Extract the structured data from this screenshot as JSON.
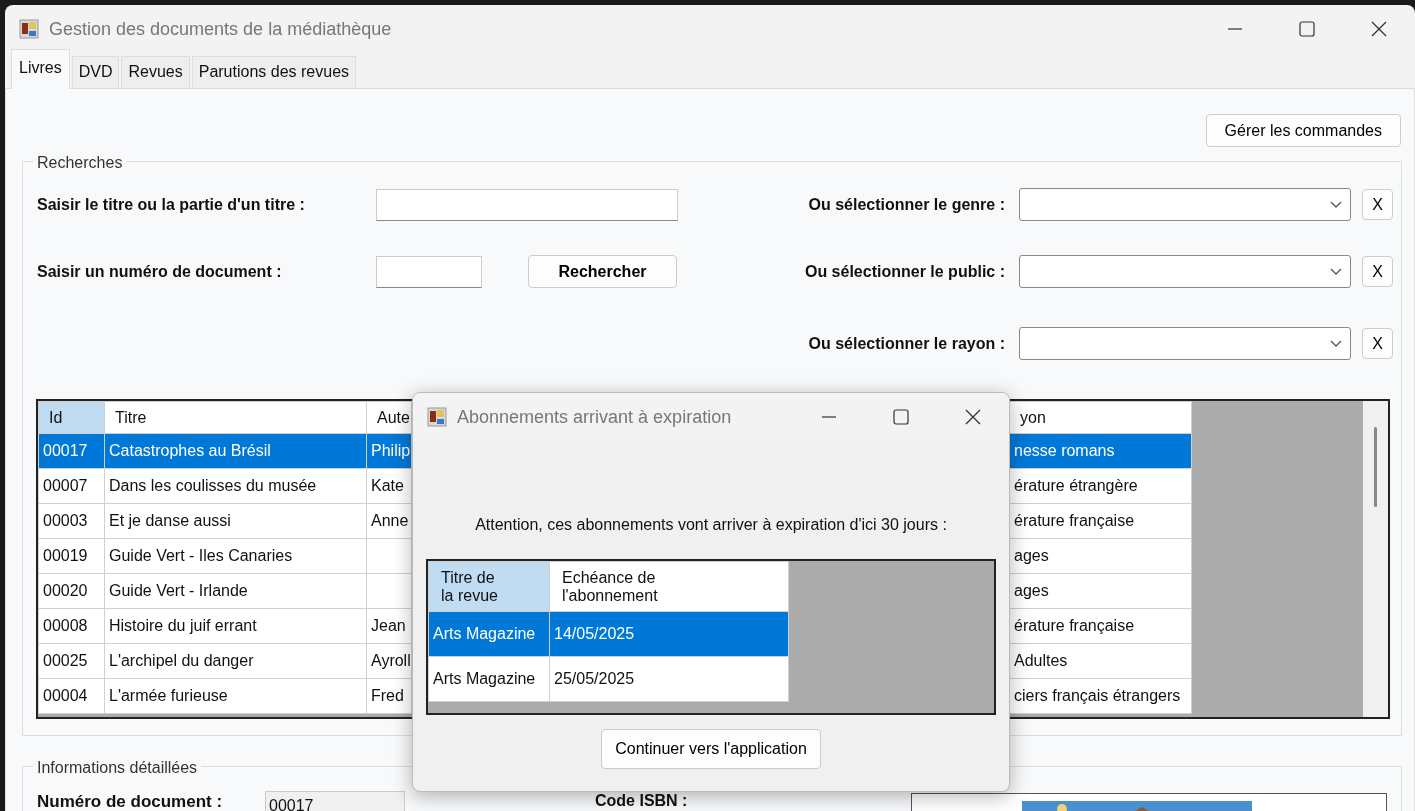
{
  "window": {
    "title": "Gestion des documents de la médiathèque"
  },
  "tabs": [
    {
      "label": "Livres",
      "selected": true
    },
    {
      "label": "DVD",
      "selected": false
    },
    {
      "label": "Revues",
      "selected": false
    },
    {
      "label": "Parutions des revues",
      "selected": false
    }
  ],
  "manage_orders_button": "Gérer les commandes",
  "search_group": {
    "title": "Recherches",
    "title_label": "Saisir le titre ou la partie d'un titre :",
    "number_label": "Saisir un numéro de document :",
    "search_button": "Rechercher",
    "filters": [
      {
        "label": "Ou sélectionner le genre :",
        "clear_button": "X"
      },
      {
        "label": "Ou sélectionner le public :",
        "clear_button": "X"
      },
      {
        "label": "Ou sélectionner le rayon :",
        "clear_button": "X"
      }
    ]
  },
  "books_table": {
    "columns": [
      {
        "label": "Id",
        "highlighted": true
      },
      {
        "label": "Titre",
        "highlighted": false
      },
      {
        "label": "Aute",
        "highlighted": false
      },
      {
        "label": "yon",
        "highlighted": false
      }
    ],
    "rows": [
      {
        "cells": [
          "00017",
          "Catastrophes au Brésil",
          "Philip",
          "nesse romans"
        ],
        "selected": true
      },
      {
        "cells": [
          "00007",
          "Dans les coulisses du musée",
          "Kate",
          "érature étrangère"
        ],
        "selected": false
      },
      {
        "cells": [
          "00003",
          "Et je danse aussi",
          "Anne",
          "érature française"
        ],
        "selected": false
      },
      {
        "cells": [
          "00019",
          "Guide Vert - Iles Canaries",
          "",
          "ages"
        ],
        "selected": false
      },
      {
        "cells": [
          "00020",
          "Guide Vert - Irlande",
          "",
          "ages"
        ],
        "selected": false
      },
      {
        "cells": [
          "00008",
          "Histoire du juif errant",
          "Jean",
          "érature française"
        ],
        "selected": false
      },
      {
        "cells": [
          "00025",
          "L'archipel du danger",
          "Ayroll",
          "Adultes"
        ],
        "selected": false
      },
      {
        "cells": [
          "00004",
          "L'armée furieuse",
          "Fred",
          "ciers français étrangers"
        ],
        "selected": false
      }
    ]
  },
  "details_group": {
    "title": "Informations détaillées",
    "number_label": "Numéro de document :",
    "number_value": "00017",
    "isbn_label": "Code ISBN :"
  },
  "dialog": {
    "title": "Abonnements arrivant à expiration",
    "message": "Attention, ces abonnements vont arriver à expiration d'ici 30 jours :",
    "table": {
      "columns": [
        {
          "label": "Titre de\nla revue",
          "highlighted": true
        },
        {
          "label": "Echéance de\nl'abonnement",
          "highlighted": false
        }
      ],
      "rows": [
        {
          "cells": [
            "Arts Magazine",
            "14/05/2025"
          ],
          "selected": true
        },
        {
          "cells": [
            "Arts Magazine",
            "25/05/2025"
          ],
          "selected": false
        }
      ]
    },
    "continue_button": "Continuer vers l'application"
  }
}
